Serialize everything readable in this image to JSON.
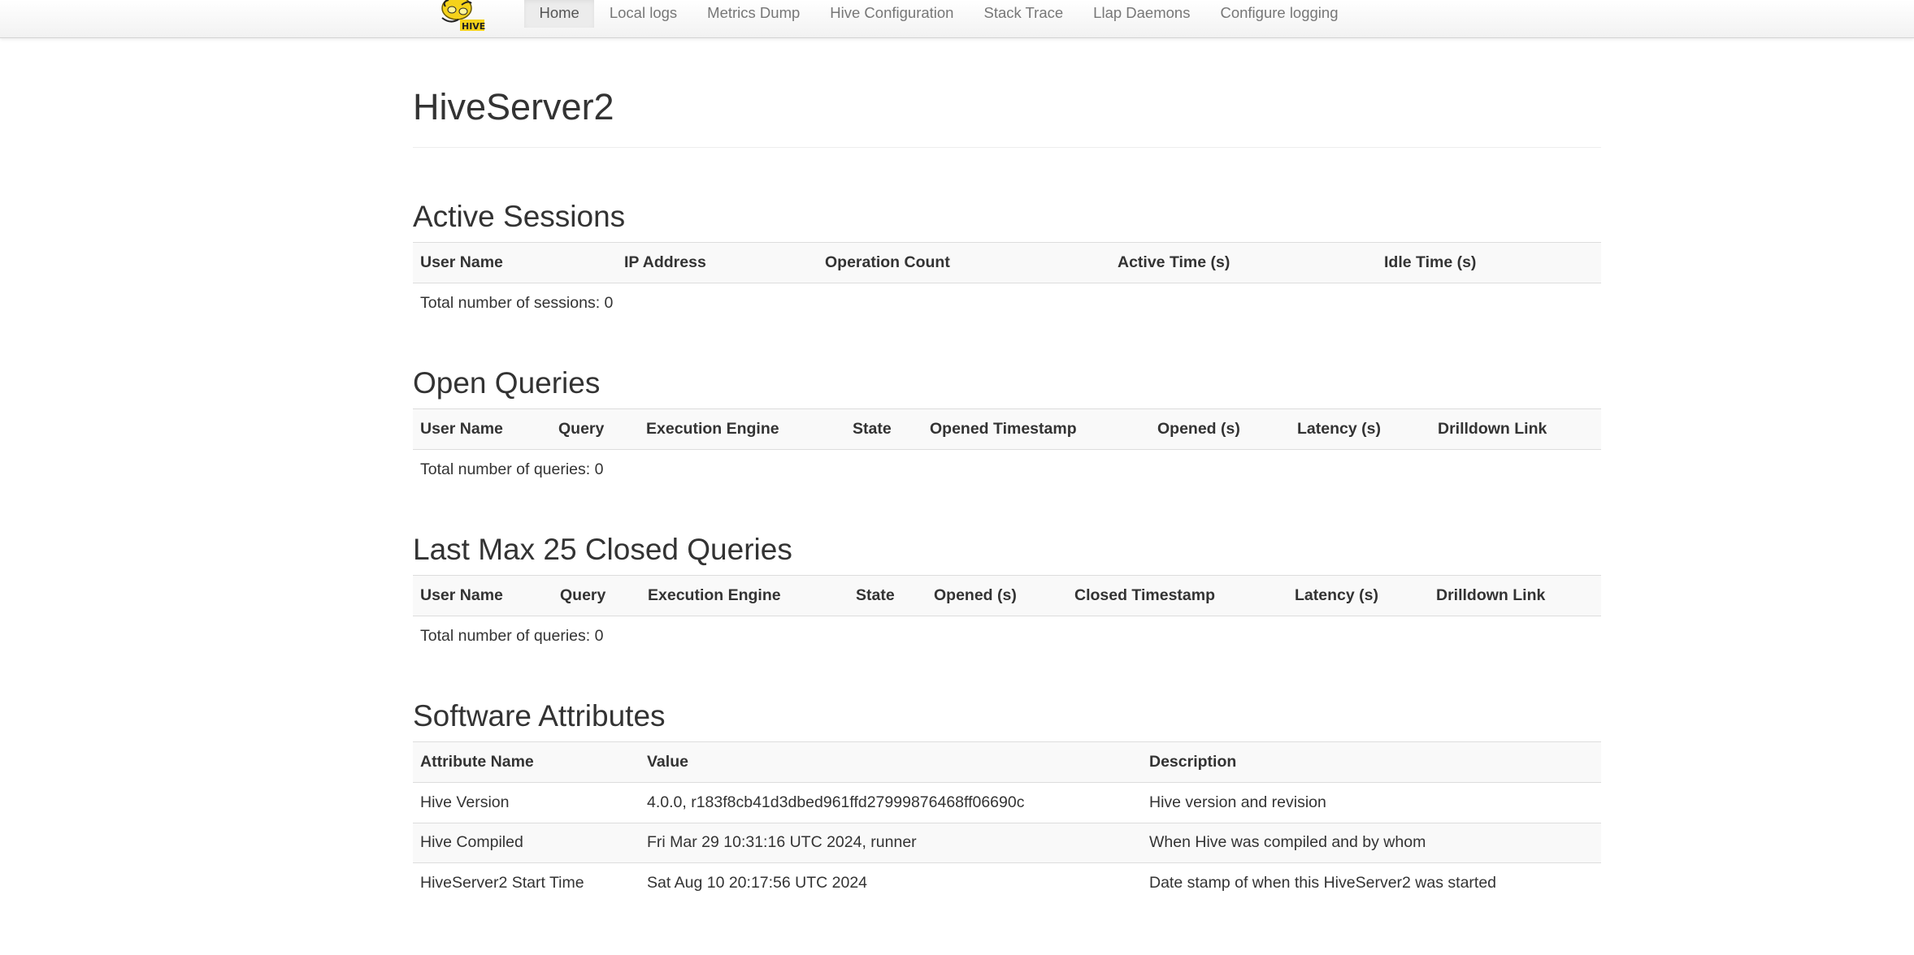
{
  "nav": {
    "items": [
      {
        "label": "Home",
        "active": true
      },
      {
        "label": "Local logs"
      },
      {
        "label": "Metrics Dump"
      },
      {
        "label": "Hive Configuration"
      },
      {
        "label": "Stack Trace"
      },
      {
        "label": "Llap Daemons"
      },
      {
        "label": "Configure logging"
      }
    ],
    "logo_text": "HIVE"
  },
  "page": {
    "title": "HiveServer2"
  },
  "active_sessions": {
    "title": "Active Sessions",
    "columns": [
      "User Name",
      "IP Address",
      "Operation Count",
      "Active Time (s)",
      "Idle Time (s)"
    ],
    "total": "Total number of sessions: 0"
  },
  "open_queries": {
    "title": "Open Queries",
    "columns": [
      "User Name",
      "Query",
      "Execution Engine",
      "State",
      "Opened Timestamp",
      "Opened (s)",
      "Latency (s)",
      "Drilldown Link"
    ],
    "total": "Total number of queries: 0"
  },
  "closed_queries": {
    "title": "Last Max 25 Closed Queries",
    "columns": [
      "User Name",
      "Query",
      "Execution Engine",
      "State",
      "Opened (s)",
      "Closed Timestamp",
      "Latency (s)",
      "Drilldown Link"
    ],
    "total": "Total number of queries: 0"
  },
  "software_attributes": {
    "title": "Software Attributes",
    "columns": [
      "Attribute Name",
      "Value",
      "Description"
    ],
    "rows": [
      [
        "Hive Version",
        "4.0.0, r183f8cb41d3dbed961ffd27999876468ff06690c",
        "Hive version and revision"
      ],
      [
        "Hive Compiled",
        "Fri Mar 29 10:31:16 UTC 2024, runner",
        "When Hive was compiled and by whom"
      ],
      [
        "HiveServer2 Start Time",
        "Sat Aug 10 20:17:56 UTC 2024",
        "Date stamp of when this HiveServer2 was started"
      ]
    ]
  },
  "colors": {
    "logo_yellow": "#f5d21a",
    "navbar_bg": "#f7f7f7"
  }
}
